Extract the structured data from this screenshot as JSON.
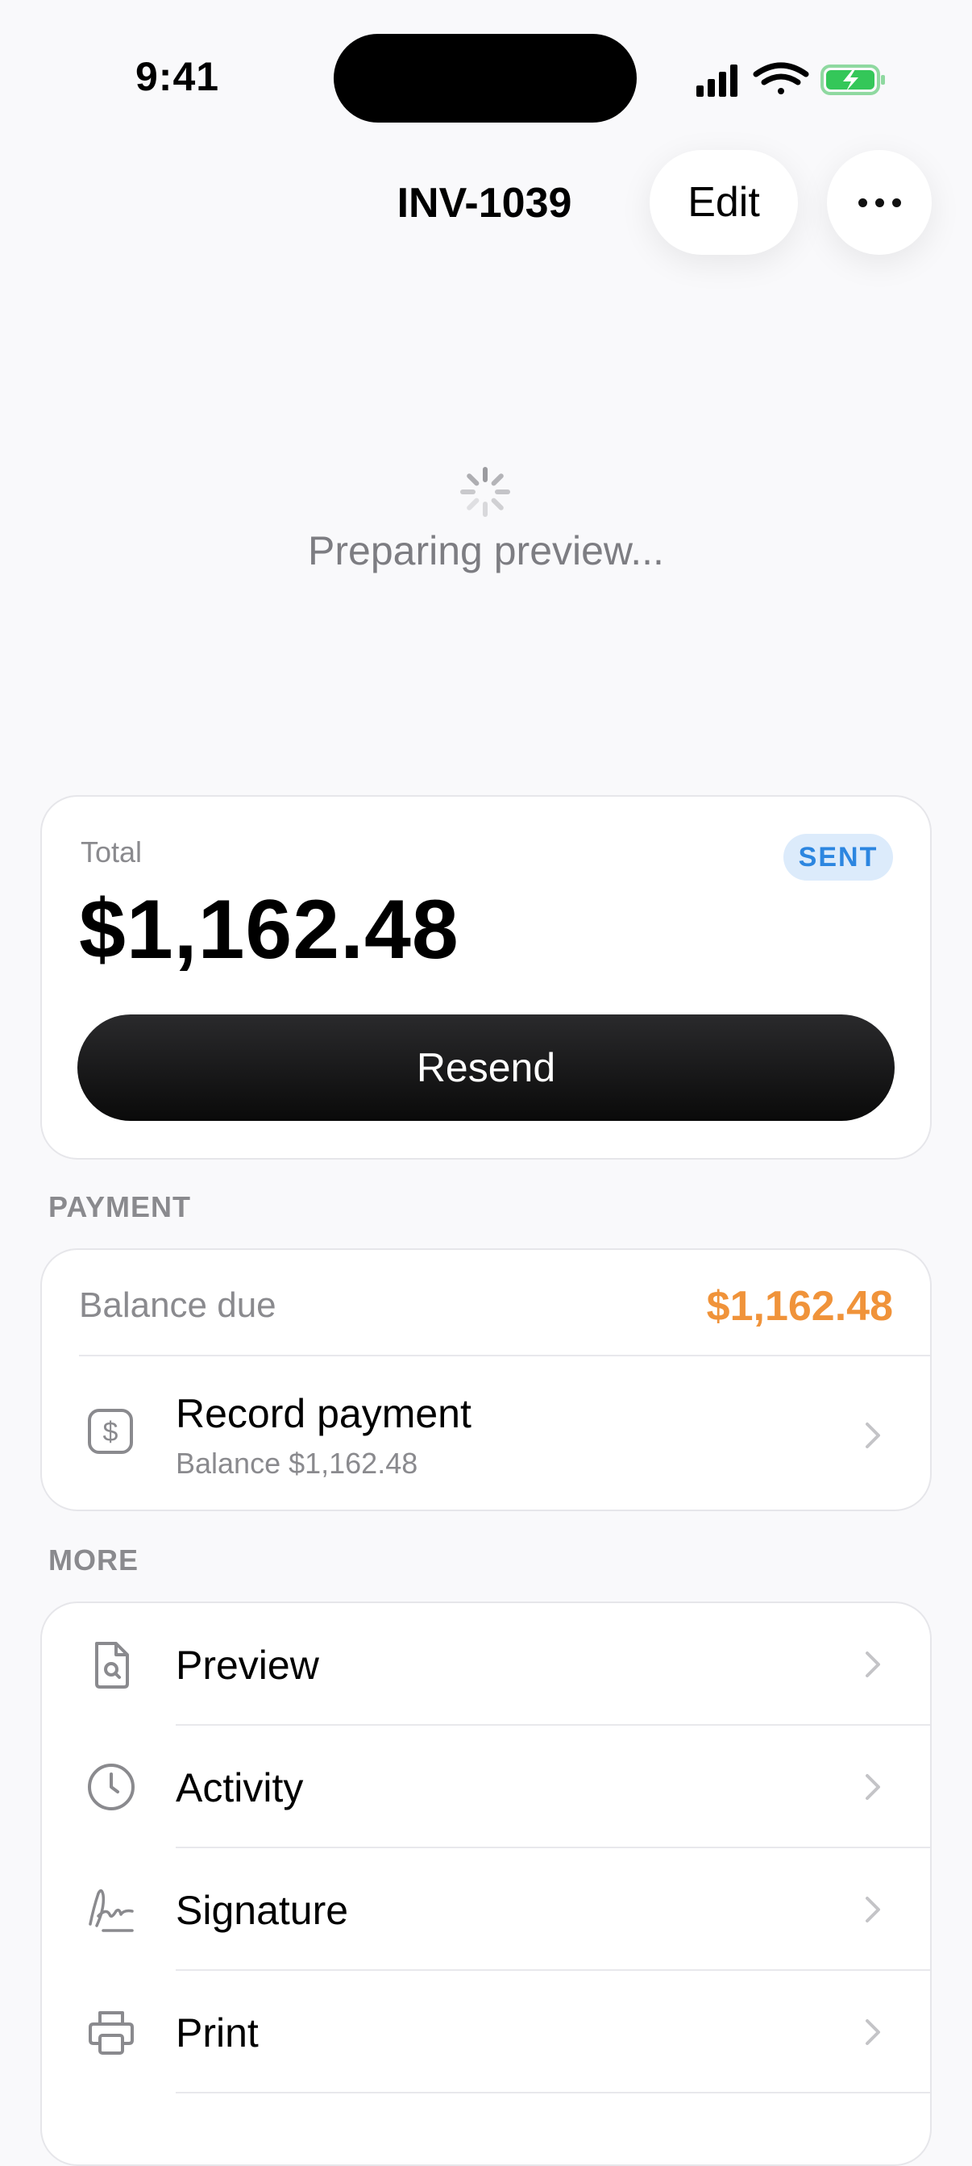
{
  "status_bar": {
    "time": "9:41"
  },
  "nav": {
    "title": "INV-1039",
    "edit_label": "Edit"
  },
  "preview": {
    "loading_text": "Preparing preview..."
  },
  "total_card": {
    "label": "Total",
    "amount": "$1,162.48",
    "status": "SENT",
    "resend_label": "Resend"
  },
  "payment": {
    "section_label": "PAYMENT",
    "balance_label": "Balance due",
    "balance_value": "$1,162.48",
    "record_title": "Record payment",
    "record_subtitle": "Balance $1,162.48"
  },
  "more": {
    "section_label": "MORE",
    "items": [
      {
        "label": "Preview",
        "icon": "document-search-icon"
      },
      {
        "label": "Activity",
        "icon": "clock-icon"
      },
      {
        "label": "Signature",
        "icon": "signature-icon"
      },
      {
        "label": "Print",
        "icon": "printer-icon"
      }
    ]
  },
  "colors": {
    "accent_orange": "#f0933a",
    "badge_blue": "#2c86e0",
    "badge_bg": "#dcebfb",
    "battery_green": "#34c759"
  }
}
